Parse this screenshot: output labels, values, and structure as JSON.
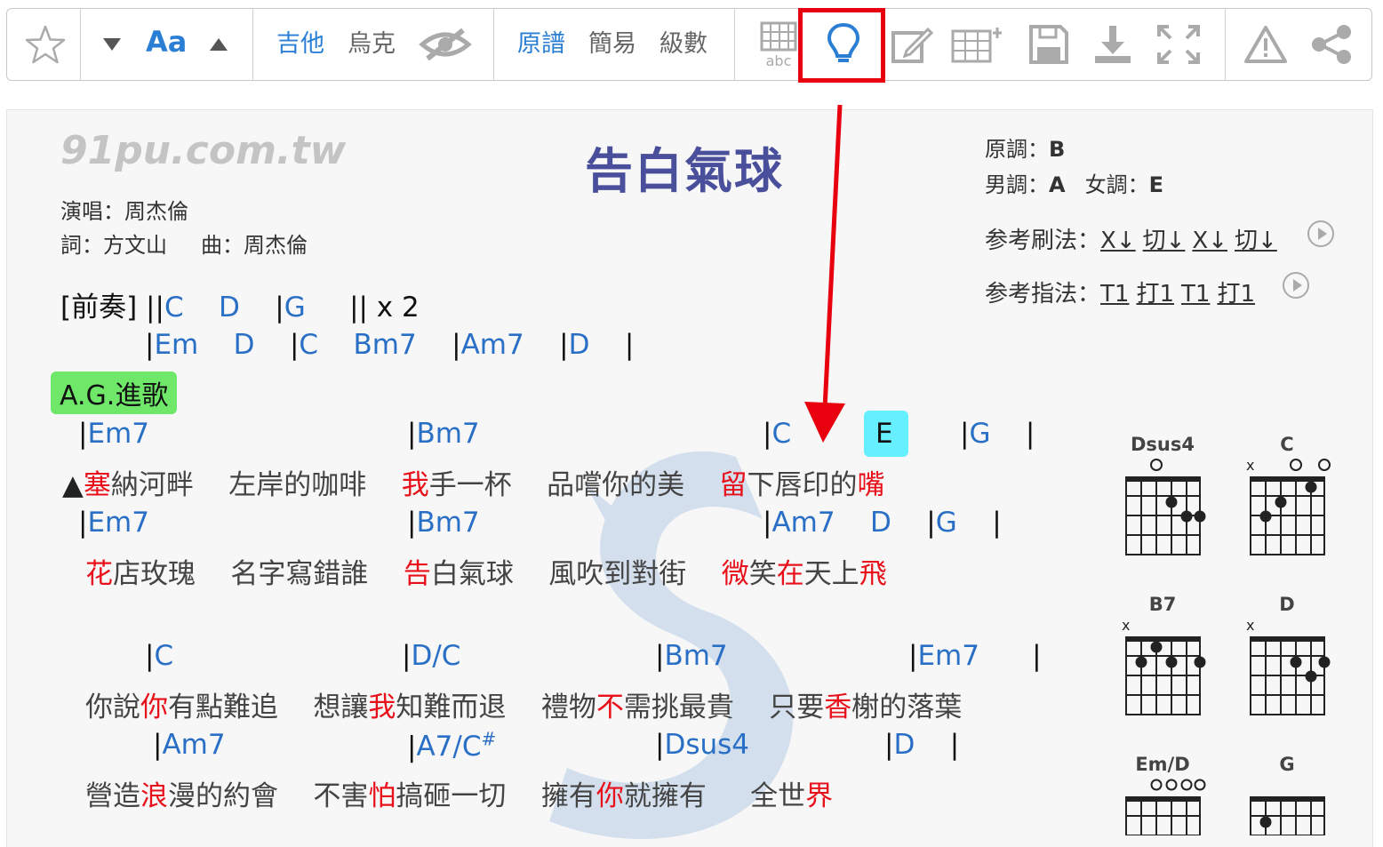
{
  "toolbar": {
    "font_label": "Aa",
    "instruments": [
      "吉他",
      "烏克"
    ],
    "modes": [
      "原譜",
      "簡易",
      "級數"
    ],
    "abc_label": "abc",
    "highlight_color": "#e8000f"
  },
  "song": {
    "site": "91pu.com.tw",
    "title": "告白氣球",
    "singer": "演唱：周杰倫",
    "lyricist": "詞：方文山",
    "composer": "曲：周杰倫",
    "orig_key_label": "原調：",
    "orig_key": "B",
    "male_key_label": "男調：",
    "male_key": "A",
    "female_key_label": "女調：",
    "female_key": "E",
    "strum_label": "参考刷法：",
    "strum": [
      "X↓",
      "切↓",
      "X↓",
      "切↓"
    ],
    "pick_label": "参考指法：",
    "pick": [
      "T1",
      "打1",
      "T1",
      "打1"
    ]
  },
  "section_tag": "A.G.進歌",
  "chord_diagrams": [
    "Dsus4",
    "C",
    "B7",
    "D",
    "Em/D",
    "G"
  ],
  "colors": {
    "chord": "#2a6fc6",
    "emphasis": "#e8101a",
    "tag": "#6fe86a",
    "current_chord": "#66f0ff"
  }
}
